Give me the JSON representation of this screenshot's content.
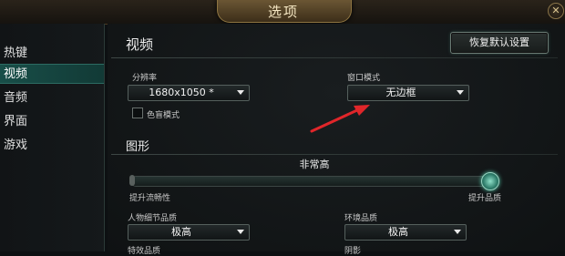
{
  "window": {
    "title": "选项",
    "close_glyph": "✕"
  },
  "sidebar": {
    "items": [
      {
        "label": "热键",
        "active": false
      },
      {
        "label": "视频",
        "active": true
      },
      {
        "label": "音频",
        "active": false
      },
      {
        "label": "界面",
        "active": false
      },
      {
        "label": "游戏",
        "active": false
      }
    ]
  },
  "video": {
    "section_title": "视频",
    "reset_label": "恢复默认设置",
    "resolution": {
      "label": "分辨率",
      "value": "1680x1050 *"
    },
    "window_mode": {
      "label": "窗口模式",
      "value": "无边框"
    },
    "color_blind": {
      "label": "色盲模式",
      "checked": false
    }
  },
  "graphics": {
    "section_title": "图形",
    "preset_value": "非常高",
    "slider_level": 1.0,
    "slider_left_label": "提升流畅性",
    "slider_right_label": "提升品质",
    "character_quality": {
      "label": "人物细节品质",
      "value": "极高"
    },
    "environment_quality": {
      "label": "环境品质",
      "value": "极高"
    },
    "effects_quality": {
      "label": "特效品质"
    },
    "shadows": {
      "label": "阴影"
    }
  },
  "annotation": {
    "color": "#e0262a"
  }
}
